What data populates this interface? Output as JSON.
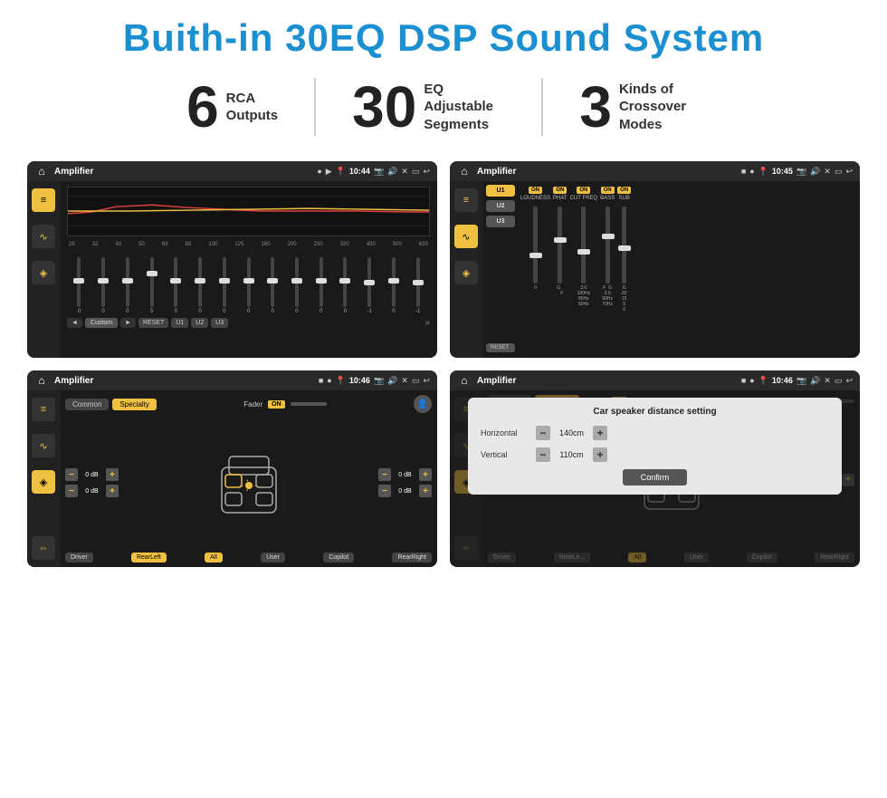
{
  "header": {
    "title": "Buith-in 30EQ DSP Sound System"
  },
  "stats": [
    {
      "number": "6",
      "label": "RCA\nOutputs"
    },
    {
      "number": "30",
      "label": "EQ Adjustable\nSegments"
    },
    {
      "number": "3",
      "label": "Kinds of\nCrossover Modes"
    }
  ],
  "screens": [
    {
      "id": "screen1",
      "title": "Amplifier",
      "time": "10:44",
      "eq_freqs": [
        "25",
        "32",
        "40",
        "50",
        "63",
        "80",
        "100",
        "125",
        "160",
        "200",
        "250",
        "320",
        "400",
        "500",
        "630"
      ],
      "eq_values": [
        "0",
        "0",
        "0",
        "5",
        "0",
        "0",
        "0",
        "0",
        "0",
        "0",
        "0",
        "0",
        "-1",
        "0",
        "-1"
      ],
      "buttons": [
        "◄",
        "Custom",
        "►",
        "RESET",
        "U1",
        "U2",
        "U3"
      ]
    },
    {
      "id": "screen2",
      "title": "Amplifier",
      "time": "10:45",
      "presets": [
        "U1",
        "U2",
        "U3"
      ],
      "toggles": [
        "LOUDNESS",
        "PHAT",
        "CUT FREQ",
        "BASS",
        "SUB"
      ],
      "reset": "RESET"
    },
    {
      "id": "screen3",
      "title": "Amplifier",
      "time": "10:46",
      "tabs": [
        "Common",
        "Specialty"
      ],
      "fader": "Fader",
      "fader_on": "ON",
      "db_values": [
        "0 dB",
        "0 dB",
        "0 dB",
        "0 dB"
      ],
      "bottom_buttons": [
        "Driver",
        "RearLeft",
        "All",
        "User",
        "Copilot",
        "RearRight"
      ]
    },
    {
      "id": "screen4",
      "title": "Amplifier",
      "time": "10:46",
      "dialog": {
        "title": "Car speaker distance setting",
        "horizontal_label": "Horizontal",
        "horizontal_value": "140cm",
        "vertical_label": "Vertical",
        "vertical_value": "110cm",
        "confirm_label": "Confirm"
      }
    }
  ],
  "colors": {
    "accent": "#f0c040",
    "header_blue": "#1a8fd1",
    "bg_dark": "#1a1a1a",
    "bg_medium": "#2a2a2a"
  }
}
